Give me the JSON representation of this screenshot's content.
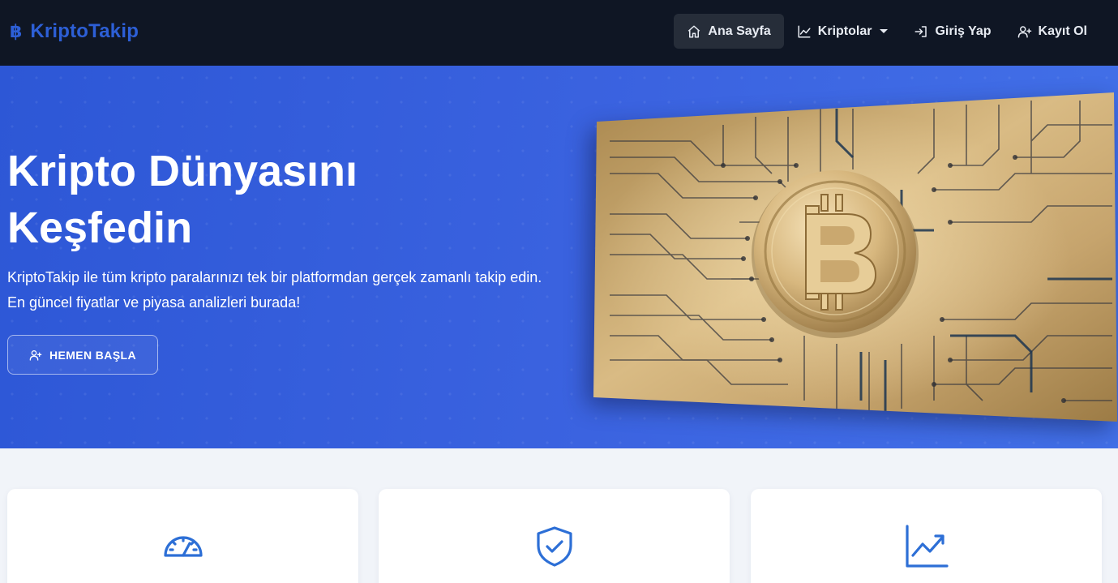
{
  "brand": {
    "icon": "฿",
    "name": "KriptoTakip"
  },
  "nav": {
    "items": [
      {
        "label": "Ana Sayfa",
        "icon": "home-icon",
        "active": true
      },
      {
        "label": "Kriptolar",
        "icon": "chart-line-icon",
        "dropdown": true
      },
      {
        "label": "Giriş Yap",
        "icon": "sign-in-icon"
      },
      {
        "label": "Kayıt Ol",
        "icon": "user-plus-icon"
      }
    ]
  },
  "hero": {
    "title": "Kripto Dünyasını Keşfedin",
    "text": "KriptoTakip ile tüm kripto paralarınızı tek bir platformdan gerçek zamanlı takip edin. En güncel fiyatlar ve piyasa analizleri burada!",
    "button_label": "HEMEN BAŞLA",
    "button_icon": "user-plus-icon",
    "image": "bitcoin-circuit-board"
  },
  "features": [
    {
      "icon": "speedometer-icon"
    },
    {
      "icon": "shield-check-icon"
    },
    {
      "icon": "graph-up-icon"
    }
  ],
  "colors": {
    "navbar_bg": "#0f1624",
    "brand": "#2d5fd6",
    "hero_bg": "#3b63e0",
    "page_bg": "#f1f4f9",
    "accent": "#2d6fd6"
  }
}
